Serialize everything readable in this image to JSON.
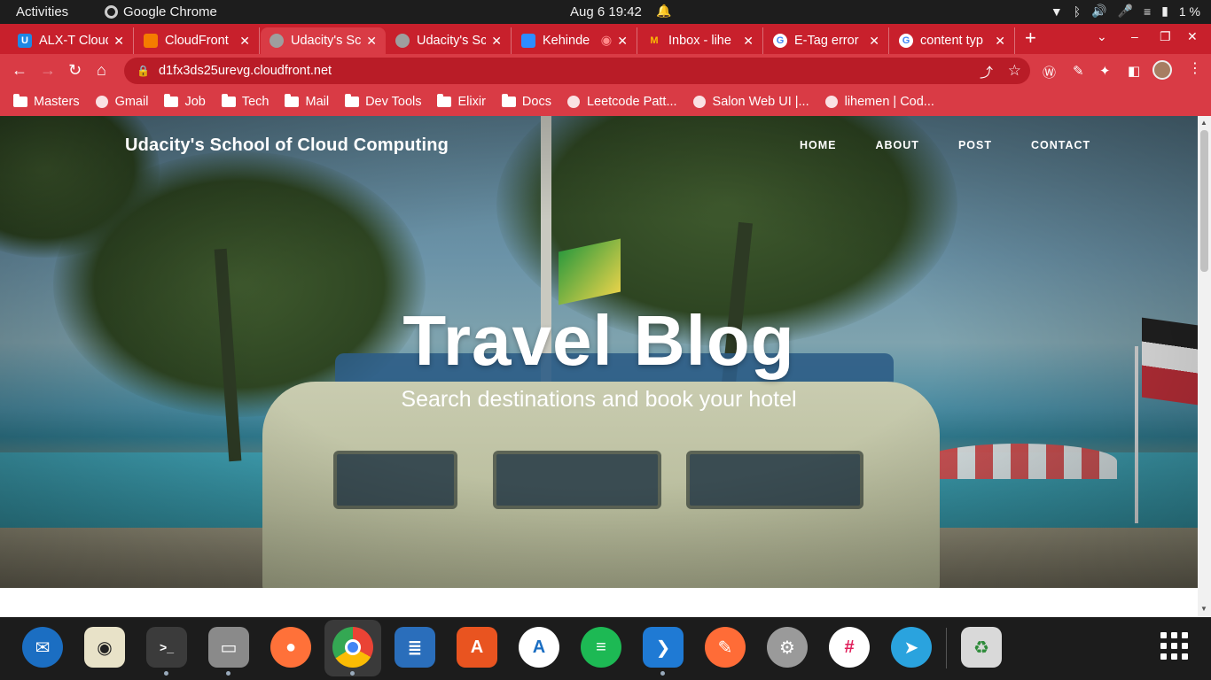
{
  "topbar": {
    "activities": "Activities",
    "app_name": "Google Chrome",
    "clock": "Aug 6  19:42",
    "battery": "1 %"
  },
  "tabs": [
    {
      "title": "ALX-T Cloud",
      "favicon_color": "#1e88e5",
      "favicon_glyph": "U"
    },
    {
      "title": "CloudFront",
      "favicon_color": "#f57c00",
      "favicon_glyph": ""
    },
    {
      "title": "Udacity's Sc",
      "favicon_color": "#9e9e9e",
      "favicon_glyph": "",
      "active": true
    },
    {
      "title": "Udacity's Sc",
      "favicon_color": "#9e9e9e",
      "favicon_glyph": ""
    },
    {
      "title": "Kehinde",
      "favicon_color": "#2d8cff",
      "favicon_glyph": ""
    },
    {
      "title": "Inbox - lihe",
      "favicon_color": "#ea4335",
      "favicon_glyph": "M"
    },
    {
      "title": "E-Tag error",
      "favicon_color": "#ffffff",
      "favicon_glyph": "G"
    },
    {
      "title": "content typ",
      "favicon_color": "#ffffff",
      "favicon_glyph": "G"
    }
  ],
  "toolbar": {
    "url": "d1fx3ds25urevg.cloudfront.net"
  },
  "bookmarks": [
    {
      "label": "Masters",
      "type": "folder"
    },
    {
      "label": "Gmail",
      "type": "site"
    },
    {
      "label": "Job",
      "type": "folder"
    },
    {
      "label": "Tech",
      "type": "folder"
    },
    {
      "label": "Mail",
      "type": "folder"
    },
    {
      "label": "Dev Tools",
      "type": "folder"
    },
    {
      "label": "Elixir",
      "type": "folder"
    },
    {
      "label": "Docs",
      "type": "folder"
    },
    {
      "label": "Leetcode Patt...",
      "type": "site"
    },
    {
      "label": "Salon Web UI |...",
      "type": "site"
    },
    {
      "label": "lihemen | Cod...",
      "type": "site"
    }
  ],
  "site": {
    "brand": "Udacity's School of Cloud Computing",
    "nav": [
      "HOME",
      "ABOUT",
      "POST",
      "CONTACT"
    ],
    "hero_title": "Travel Blog",
    "hero_subtitle": "Search destinations and book your hotel"
  },
  "dock": {
    "apps": [
      {
        "name": "thunderbird",
        "color": "#1b6ec2"
      },
      {
        "name": "rhythmbox",
        "color": "#e8e2c8"
      },
      {
        "name": "terminal",
        "color": "#3b3b3b"
      },
      {
        "name": "files",
        "color": "#8a8a8a"
      },
      {
        "name": "firefox",
        "color": "#ff7139"
      },
      {
        "name": "chrome",
        "color": "#34a853"
      },
      {
        "name": "libreoffice-writer",
        "color": "#2a6ebb"
      },
      {
        "name": "software-center",
        "color": "#e95420"
      },
      {
        "name": "android-studio",
        "color": "#ffffff"
      },
      {
        "name": "spotify",
        "color": "#1db954"
      },
      {
        "name": "vscode",
        "color": "#1f7ad4"
      },
      {
        "name": "postman",
        "color": "#ff6c37"
      },
      {
        "name": "settings",
        "color": "#9a9a9a"
      },
      {
        "name": "slack",
        "color": "#ffffff"
      },
      {
        "name": "telegram",
        "color": "#2aa3de"
      },
      {
        "name": "trash",
        "color": "#d9d9d9"
      }
    ]
  }
}
